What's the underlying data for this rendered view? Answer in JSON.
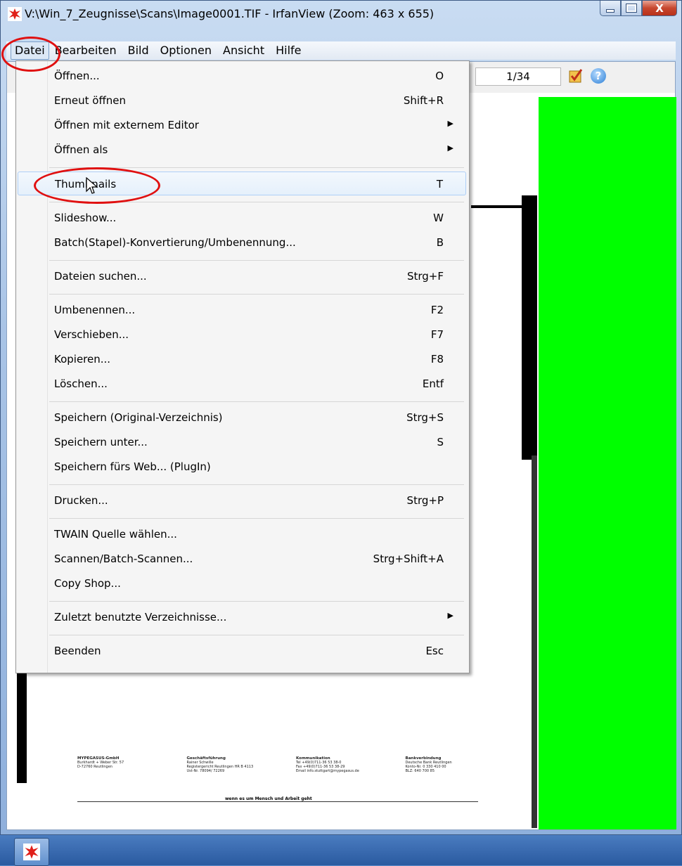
{
  "window": {
    "title": "V:\\Win_7_Zeugnisse\\Scans\\Image0001.TIF - IrfanView (Zoom: 463 x 655)",
    "buttons": {
      "minimize": "—",
      "maximize": "☐",
      "close": "X"
    }
  },
  "menubar": {
    "items": [
      {
        "label": "Datei"
      },
      {
        "label": "Bearbeiten"
      },
      {
        "label": "Bild"
      },
      {
        "label": "Optionen"
      },
      {
        "label": "Ansicht"
      },
      {
        "label": "Hilfe"
      }
    ]
  },
  "toolbar": {
    "page_counter": "1/34",
    "help_glyph": "?"
  },
  "file_menu": {
    "items": [
      {
        "label": "Öffnen...",
        "shortcut": "O"
      },
      {
        "label": "Erneut öffnen",
        "shortcut": "Shift+R"
      },
      {
        "label": "Öffnen mit externem Editor",
        "shortcut": "",
        "submenu": true
      },
      {
        "label": "Öffnen als",
        "shortcut": "",
        "submenu": true
      },
      {
        "label": "Thumbnails",
        "shortcut": "T",
        "highlighted": true
      },
      {
        "label": "Slideshow...",
        "shortcut": "W"
      },
      {
        "label": "Batch(Stapel)-Konvertierung/Umbenennung...",
        "shortcut": "B"
      },
      {
        "label": "Dateien suchen...",
        "shortcut": "Strg+F"
      },
      {
        "label": "Umbenennen...",
        "shortcut": "F2"
      },
      {
        "label": "Verschieben...",
        "shortcut": "F7"
      },
      {
        "label": "Kopieren...",
        "shortcut": "F8"
      },
      {
        "label": "Löschen...",
        "shortcut": "Entf"
      },
      {
        "label": "Speichern (Original-Verzeichnis)",
        "shortcut": "Strg+S"
      },
      {
        "label": "Speichern unter...",
        "shortcut": "S"
      },
      {
        "label": "Speichern fürs Web... (PlugIn)",
        "shortcut": ""
      },
      {
        "label": "Drucken...",
        "shortcut": "Strg+P"
      },
      {
        "label": "TWAIN Quelle wählen...",
        "shortcut": ""
      },
      {
        "label": "Scannen/Batch-Scannen...",
        "shortcut": "Strg+Shift+A"
      },
      {
        "label": "Copy Shop...",
        "shortcut": ""
      },
      {
        "label": "Zuletzt benutzte Verzeichnisse...",
        "shortcut": "",
        "submenu": true
      },
      {
        "label": "Beenden",
        "shortcut": "Esc"
      }
    ],
    "submenu_glyph": "▶"
  },
  "document_footer": {
    "col1": [
      "MYPEGASUS-GmbH",
      "Burkhardt + Weber Str. 57",
      "D-72760 Reutlingen"
    ],
    "col2": [
      "Geschäftsführung",
      "Rainer Schwille",
      "Registergericht Reutlingen HR B 4113",
      "Ust-Nr. 78094/ 72269"
    ],
    "col3": [
      "Kommunikation",
      "Tel   +49(0)711-36 53 38-0",
      "Fax   +49(0)711-36 53 38-29",
      "Email info.stuttgart@mypegasus.de"
    ],
    "col4": [
      "Bankverbindung",
      "Deutsche Bank Reutlingen",
      "Konto-Nr. 0 330 410 00",
      "BLZ: 640 700 85"
    ],
    "slogan": "wenn es um Mensch und Arbeit geht"
  },
  "colors": {
    "annotation": "#e01010",
    "green_panel": "#00ff00",
    "menu_highlight": "#e5f0fb"
  }
}
